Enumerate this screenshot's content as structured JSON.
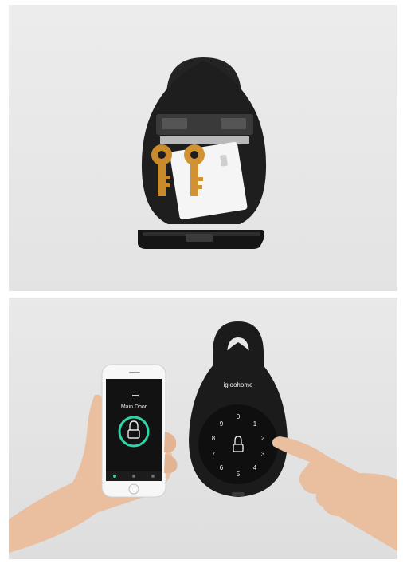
{
  "photo_top": {
    "alt": "Open key safe with two brass keys and a card inside"
  },
  "photo_bottom": {
    "brand": "igloohome",
    "phone_screen_title": "Main Door",
    "keypad_digits": [
      "0",
      "1",
      "2",
      "3",
      "4",
      "5",
      "6",
      "7",
      "8",
      "9"
    ]
  },
  "colors": {
    "device_body": "#1b1b1b",
    "ring_accent": "#2fd5a6",
    "brass": "#c98a2c"
  }
}
